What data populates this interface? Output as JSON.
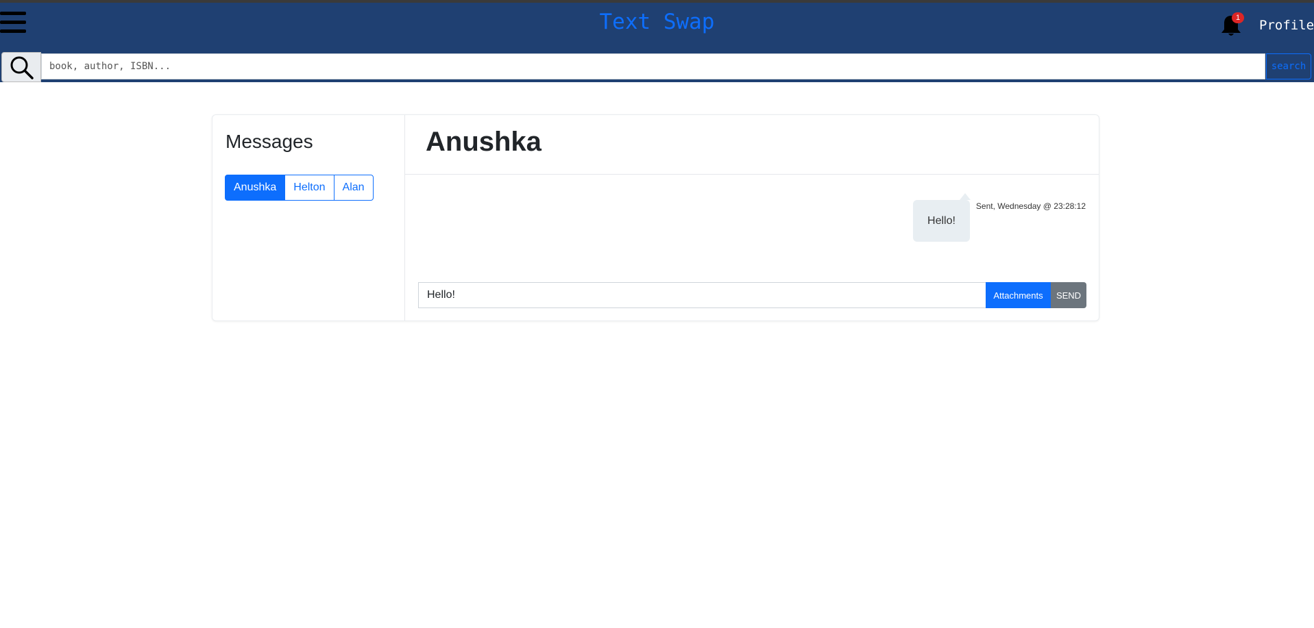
{
  "header": {
    "brand": "Text Swap",
    "notification_count": "1",
    "profile_label": "Profile",
    "menu_icon": "hamburger-icon",
    "bell_icon": "bell-icon"
  },
  "search": {
    "placeholder": "book, author, ISBN...",
    "value": "",
    "button_label": "search",
    "icon": "magnifier-icon"
  },
  "sidebar": {
    "title": "Messages",
    "contacts": [
      {
        "label": "Anushka",
        "active": true
      },
      {
        "label": "Helton",
        "active": false
      },
      {
        "label": "Alan",
        "active": false
      }
    ]
  },
  "chat": {
    "recipient": "Anushka",
    "messages": [
      {
        "text": "Hello!",
        "meta": "Sent, Wednesday @ 23:28:12"
      }
    ],
    "composer": {
      "value": "Hello!",
      "attach_label": "Attachments",
      "send_label": "SEND"
    }
  },
  "colors": {
    "navbar": "#1f4072",
    "brand_accent": "#0d6efd",
    "notification_badge": "#dc2626",
    "send_button": "#6c757d",
    "bubble": "#e8eef2"
  }
}
